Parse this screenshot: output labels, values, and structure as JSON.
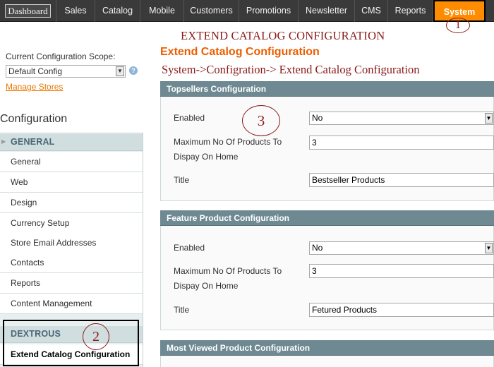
{
  "nav": {
    "items": [
      "Dashboard",
      "Sales",
      "Catalog",
      "Mobile",
      "Customers",
      "Promotions",
      "Newsletter",
      "CMS",
      "Reports",
      "System"
    ],
    "active": "System"
  },
  "overlay": {
    "title": "EXTEND CATALOG CONFIGURATION",
    "path": "System->Configration-> Extend Catalog Configuration",
    "markers": [
      "1",
      "2",
      "3"
    ],
    "marker_color": "#8b1a1a"
  },
  "page_heading": "Extend Catalog Configuration",
  "scope": {
    "label": "Current Configuration Scope:",
    "value": "Default Config",
    "help_icon": "?",
    "manage_stores": "Manage Stores"
  },
  "sidebar": {
    "title": "Configuration",
    "groups": [
      {
        "label": "GENERAL",
        "items": [
          "General",
          "Web",
          "Design",
          "Currency Setup",
          "Store Email Addresses",
          "Contacts",
          "Reports",
          "Content Management"
        ]
      },
      {
        "label": "DEXTROUS",
        "items": [
          "Extend Catalog Configuration"
        ]
      }
    ]
  },
  "panels": {
    "topsellers": {
      "header": "Topsellers Configuration",
      "enabled_label": "Enabled",
      "enabled_value": "No",
      "max_label_line1": "Maximum No Of Products To",
      "max_label_line2": "Dispay On Home",
      "max_value": "3",
      "title_label": "Title",
      "title_value": "Bestseller Products"
    },
    "feature": {
      "header": "Feature Product Configuration",
      "enabled_label": "Enabled",
      "enabled_value": "No",
      "max_label_line1": "Maximum No Of Products To",
      "max_label_line2": "Dispay On Home",
      "max_value": "3",
      "title_label": "Title",
      "title_value": "Fetured Products"
    },
    "most_viewed": {
      "header": "Most Viewed Product Configuration"
    }
  },
  "colors": {
    "nav_bg": "#3a3a3a",
    "active_tab": "#ff8c00",
    "accent_orange": "#eb5e00",
    "panel_header": "#6f8992",
    "sidebar_group": "#d1dedf"
  }
}
